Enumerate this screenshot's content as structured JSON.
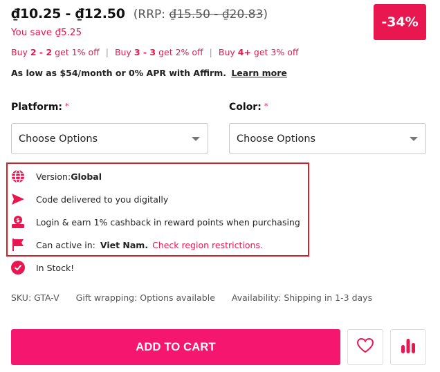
{
  "pricing": {
    "price_range": "₫10.25 - ₫12.50",
    "rrp_prefix": "(RRP: ",
    "rrp_range": "₫15.50 - ₫20.83",
    "rrp_suffix": ")",
    "discount_badge": "-34%",
    "you_save": "You save ₫5.25"
  },
  "bulk_offers": [
    {
      "prefix": "Buy ",
      "qty": "2 - 2",
      "suffix": " get 1% off"
    },
    {
      "prefix": "Buy ",
      "qty": "3 - 3",
      "suffix": " get 2% off"
    },
    {
      "prefix": "Buy ",
      "qty": "4+",
      "suffix": " get 3% off"
    }
  ],
  "affirm": {
    "text": "As low as $54/month or 0% APR with Affirm.",
    "link_label": "Learn more"
  },
  "options": {
    "platform": {
      "label": "Platform:",
      "required_mark": "*",
      "selected": "Choose Options"
    },
    "color": {
      "label": "Color:",
      "required_mark": "*",
      "selected": "Choose Options"
    }
  },
  "info": {
    "version_label": "Version: ",
    "version_value": "Global",
    "delivery": "Code delivered to you digitally",
    "cashback": "Login & earn 1% cashback in reward points when purchasing",
    "region_label": "Can active in:",
    "region_country": "Viet Nam.",
    "region_link": "Check region restrictions."
  },
  "stock": {
    "status": "In Stock!"
  },
  "meta": {
    "sku": "SKU: GTA-V",
    "gift": "Gift wrapping: Options available",
    "availability": "Availability: Shipping in 1-3 days"
  },
  "actions": {
    "add_to_cart": "ADD TO CART"
  },
  "icons": {
    "version": "globe-icon",
    "delivery": "send-icon",
    "cashback": "cashback-icon",
    "region": "flag-icon",
    "stock": "check-circle-icon",
    "wishlist": "heart-icon",
    "compare": "bar-chart-icon"
  },
  "colors": {
    "accent": "#e8174f",
    "cart_button": "#f5166f",
    "highlight_border": "#d91f26"
  }
}
